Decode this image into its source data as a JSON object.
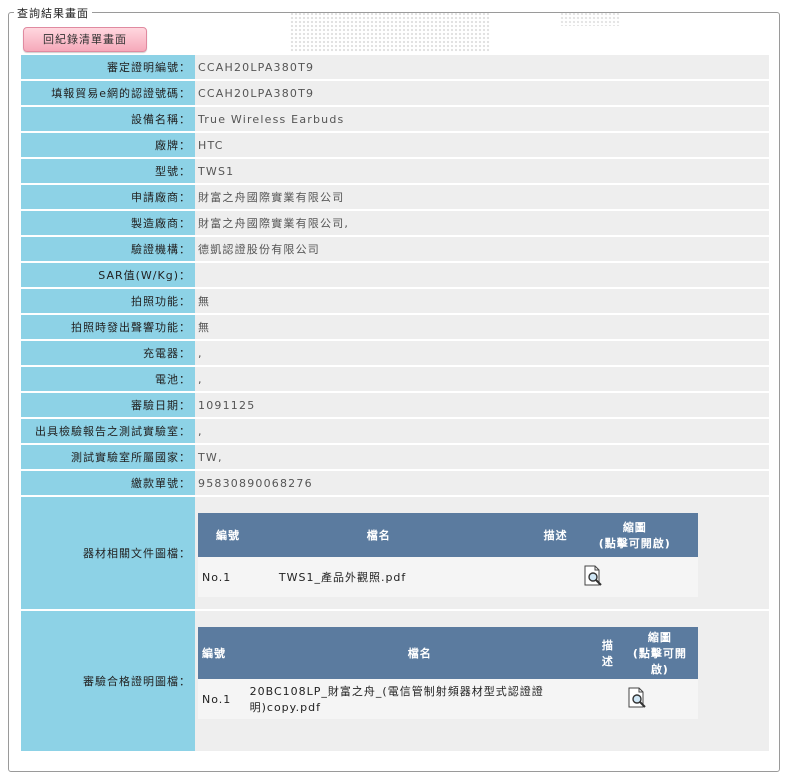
{
  "section_title": "查詢結果畫面",
  "back_button": "回紀錄清單畫面",
  "rows": [
    {
      "label": "審定證明編號：",
      "value": "CCAH20LPA380T9"
    },
    {
      "label": "填報貿易e網的認證號碼：",
      "value": "CCAH20LPA380T9"
    },
    {
      "label": "設備名稱：",
      "value": "True Wireless Earbuds"
    },
    {
      "label": "廠牌：",
      "value": "HTC"
    },
    {
      "label": "型號：",
      "value": "TWS1"
    },
    {
      "label": "申請廠商：",
      "value": "財富之舟國際實業有限公司"
    },
    {
      "label": "製造廠商：",
      "value": "財富之舟國際實業有限公司,"
    },
    {
      "label": "驗證機構：",
      "value": "德凱認證股份有限公司"
    },
    {
      "label": "SAR值(W/Kg)：",
      "value": ""
    },
    {
      "label": "拍照功能：",
      "value": "無"
    },
    {
      "label": "拍照時發出聲響功能：",
      "value": "無"
    },
    {
      "label": "充電器：",
      "value": ","
    },
    {
      "label": "電池：",
      "value": ","
    },
    {
      "label": "審驗日期：",
      "value": "1091125"
    },
    {
      "label": "出具檢驗報告之測試實驗室：",
      "value": ","
    },
    {
      "label": "測試實驗室所屬國家：",
      "value": "TW,"
    },
    {
      "label": "繳款單號：",
      "value": "95830890068276"
    }
  ],
  "equipment_docs": {
    "label": "器材相關文件圖檔：",
    "headers": {
      "no": "編號",
      "file": "檔名",
      "desc": "描述",
      "thumb": "縮圖",
      "thumb_note": "(點擊可開啟)"
    },
    "items": [
      {
        "no": "No.1",
        "file": "TWS1_產品外觀照.pdf",
        "desc": ""
      }
    ]
  },
  "approval_docs": {
    "label": "審驗合格證明圖檔：",
    "headers": {
      "no": "編號",
      "file": "檔名",
      "desc": "描述",
      "thumb": "縮圖",
      "thumb_note": "(點擊可開啟)"
    },
    "items": [
      {
        "no": "No.1",
        "file": "20BC108LP_財富之舟_(電信管制射頻器材型式認證證明)copy.pdf",
        "desc": ""
      }
    ]
  },
  "icons": {
    "thumbnail": "document-magnifier-icon"
  }
}
